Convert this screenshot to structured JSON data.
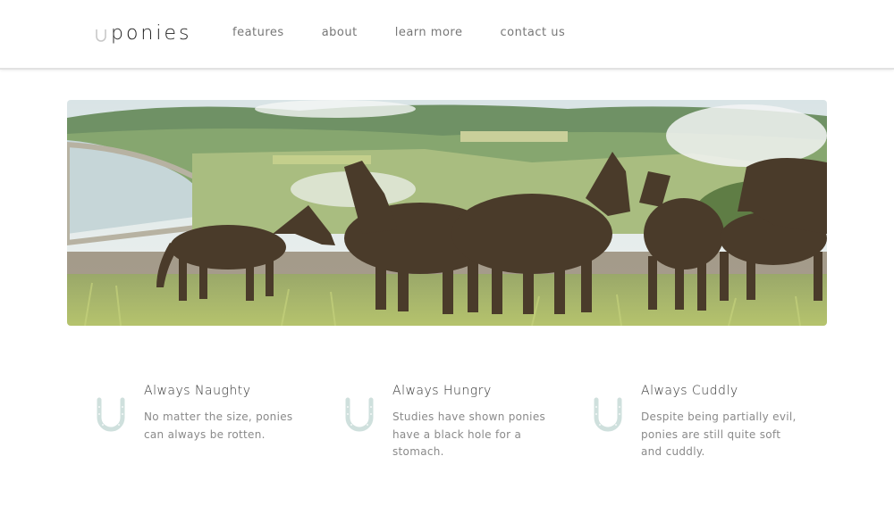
{
  "brand": {
    "name": "ponies",
    "icon": "horseshoe-icon"
  },
  "nav": {
    "items": [
      "features",
      "about",
      "learn more",
      "contact us"
    ]
  },
  "hero": {
    "image": "herd-of-ponies-on-moorland-photo"
  },
  "features": [
    {
      "icon": "horseshoe-icon",
      "title": "Always Naughty",
      "text": "No matter the size, ponies can always be rotten."
    },
    {
      "icon": "horseshoe-icon",
      "title": "Always Hungry",
      "text": "Studies have shown ponies have a black hole for a stomach."
    },
    {
      "icon": "horseshoe-icon",
      "title": "Always Cuddly",
      "text": "Despite being partially evil, ponies are still quite soft and cuddly."
    }
  ],
  "colors": {
    "accent": "#cfe0dd",
    "text_dark": "#333333",
    "text_muted": "#8a8a8a",
    "header_border": "#e2e2e2"
  }
}
